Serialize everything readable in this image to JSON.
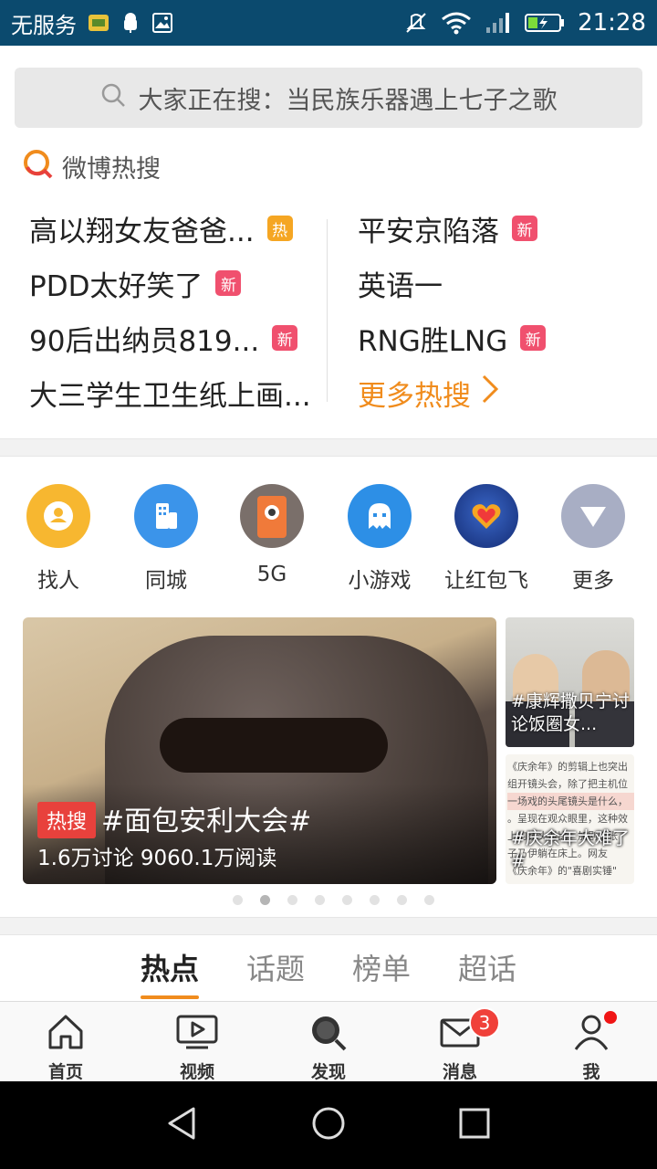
{
  "status_bar": {
    "carrier": "无服务",
    "time": "21:28",
    "icons": [
      "sim-card-icon",
      "android-debug-icon",
      "image-icon",
      "mute-icon",
      "wifi-icon",
      "signal-icon",
      "battery-charging-icon"
    ]
  },
  "search": {
    "placeholder": "大家正在搜：当民族乐器遇上七子之歌",
    "icon": "search-icon"
  },
  "hot_search": {
    "title": "微博热搜",
    "left": [
      {
        "text": "高以翔女友爸爸...",
        "badge": "热",
        "badge_type": "hot"
      },
      {
        "text": "PDD太好笑了",
        "badge": "新",
        "badge_type": "new"
      },
      {
        "text": "90后出纳员819...",
        "badge": "新",
        "badge_type": "new"
      },
      {
        "text": "大三学生卫生纸上画...",
        "badge": "",
        "badge_type": ""
      }
    ],
    "right": [
      {
        "text": "平安京陷落",
        "badge": "新",
        "badge_type": "new"
      },
      {
        "text": "英语一",
        "badge": "",
        "badge_type": ""
      },
      {
        "text": "RNG胜LNG",
        "badge": "新",
        "badge_type": "new"
      }
    ],
    "more_label": "更多热搜"
  },
  "shortcuts": [
    {
      "label": "找人",
      "icon": "find-people-icon",
      "color": "#f7b730"
    },
    {
      "label": "同城",
      "icon": "city-building-icon",
      "color": "#3b94ea"
    },
    {
      "label": "5G",
      "icon": "phone-5g-icon",
      "color": "#7a6f6a"
    },
    {
      "label": "小游戏",
      "icon": "game-ghost-icon",
      "color": "#2d8fe6"
    },
    {
      "label": "让红包飞",
      "icon": "red-packet-heart-icon",
      "color": "#1f3d8c"
    },
    {
      "label": "更多",
      "icon": "chevron-down-icon",
      "color": "#a8aec4"
    }
  ],
  "banner": {
    "tag": "热搜",
    "title": "#面包安利大会#",
    "stats": "1.6万讨论  9060.1万阅读",
    "side_cards": [
      {
        "caption": "#康辉撒贝宁讨论饭圈女..."
      },
      {
        "caption": "#庆余年大难了#",
        "doc_lines": [
          "《庆余年》的剪辑上也突出",
          "组开镜头会，除了把主机位",
          "一场戏的头尾镜头是什么，",
          "。呈现在观众眼里，这种效",
          "上的镜头对比，加剧了张",
          "子乃伊躺在床上。网友",
          "《庆余年》的\"喜剧实锤\""
        ]
      }
    ],
    "page_count": 8,
    "active_page": 1
  },
  "tabs": [
    "热点",
    "话题",
    "榜单",
    "超话"
  ],
  "active_tab": 0,
  "bottom_nav": [
    {
      "label": "首页",
      "icon": "home-icon"
    },
    {
      "label": "视频",
      "icon": "video-play-icon"
    },
    {
      "label": "发现",
      "icon": "discover-search-icon"
    },
    {
      "label": "消息",
      "icon": "mail-icon",
      "badge": "3"
    },
    {
      "label": "我",
      "icon": "profile-icon"
    }
  ],
  "system_nav": [
    "back-icon",
    "home-circle-icon",
    "recents-icon"
  ]
}
